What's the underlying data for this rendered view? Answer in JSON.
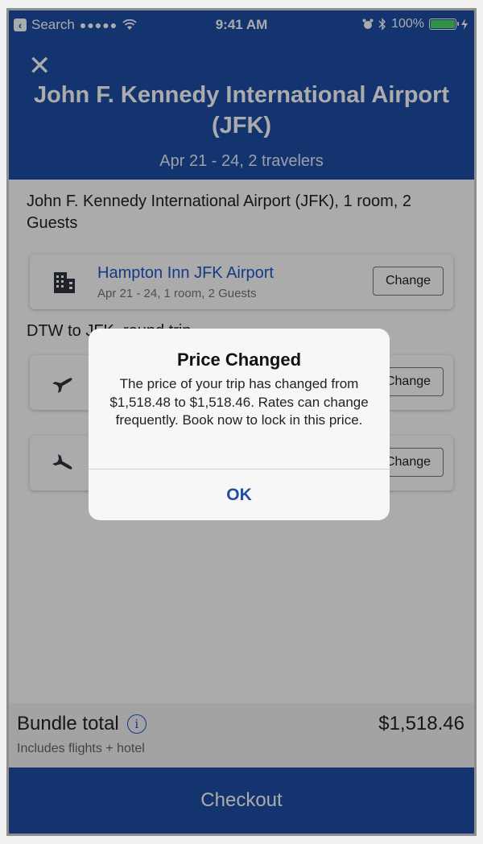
{
  "status_bar": {
    "back_label": "Search",
    "signal": "●●●●●",
    "time": "9:41 AM",
    "battery": "100%",
    "battery_level": 1.0
  },
  "header": {
    "close_icon": "close-icon",
    "title": "John F. Kennedy International Airport (JFK)",
    "subtitle": "Apr 21 - 24, 2 travelers"
  },
  "trip": {
    "hotel_summary": "John F. Kennedy International Airport (JFK), 1 room, 2 Guests",
    "hotel_card": {
      "name": "Hampton Inn JFK Airport",
      "details": "Apr 21 - 24, 1 room, 2 Guests",
      "change_label": "Change",
      "icon": "building-icon"
    },
    "flight_section_label": "DTW to JFK, round trip",
    "flight_cards": [
      {
        "icon": "airplane-icon",
        "change_label": "Change"
      },
      {
        "icon": "airplane-icon",
        "change_label": "Change"
      }
    ]
  },
  "bundle": {
    "label": "Bundle total",
    "total": "$1,518.46",
    "note": "Includes flights + hotel"
  },
  "checkout": {
    "label": "Checkout"
  },
  "alert": {
    "title": "Price Changed",
    "message": "The price of your trip has changed from $1,518.48 to $1,518.46. Rates can change frequently. Book now to lock in this price.",
    "ok_label": "OK"
  },
  "colors": {
    "brand_blue": "#1e4ea8",
    "link_blue": "#1e57c8",
    "battery_green": "#4cd964"
  }
}
